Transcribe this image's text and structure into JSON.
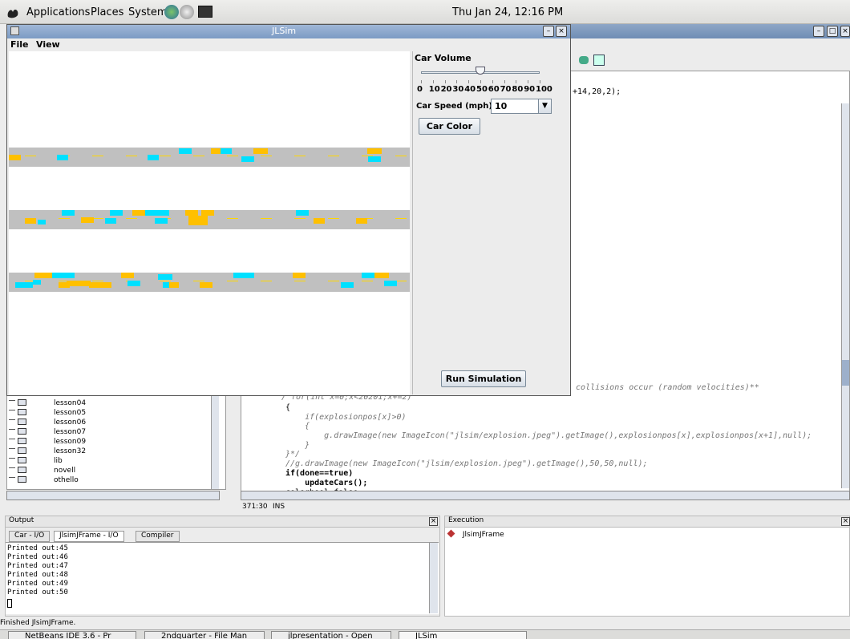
{
  "desktop": {
    "menus": [
      "Applications",
      "Places",
      "System"
    ],
    "clock": "Thu Jan 24, 12:16 PM"
  },
  "jlsim": {
    "title": "JLSim",
    "menu": [
      "File",
      "View"
    ],
    "car_volume_label": "Car Volume",
    "car_volume_value": 50,
    "car_volume_ticks": [
      "0",
      "10",
      "20",
      "30",
      "40",
      "50",
      "60",
      "70",
      "80",
      "90",
      "100"
    ],
    "car_speed_label": "Car Speed (mph):",
    "car_speed_value": "10",
    "car_color_button": "Car Color",
    "run_button": "Run Simulation",
    "colors": {
      "car_yellow": "#ffc000",
      "car_cyan": "#00e0ff",
      "road": "#c0c0c0"
    }
  },
  "editor": {
    "code_top": "+14,20,2);",
    "code_comment": "y collisions occur (random velocities)**",
    "lines": [
      "{",
      "    if(explosionpos[x]>0)",
      "    {",
      "        g.drawImage(new ImageIcon(\"jlsim/explosion.jpeg\").getImage(),explosionpos[x],explosionpos[x+1],null);",
      "    }",
      "}*/",
      "//g.drawImage(new ImageIcon(\"jlsim/explosion.jpeg\").getImage(),50,50,null);",
      "if(done==true)",
      "    updateCars();",
      "colorbool=false;"
    ],
    "cursor_pos": "371:30",
    "mode": "INS"
  },
  "project_tree": [
    "lesson04",
    "lesson05",
    "lesson06",
    "lesson07",
    "lesson09",
    "lesson32",
    "lib",
    "novell",
    "othello"
  ],
  "output": {
    "title": "Output",
    "tabs": [
      "Car - I/O",
      "JlsimJFrame - I/O",
      "Compiler"
    ],
    "lines": [
      "Printed out:45",
      "Printed out:46",
      "Printed out:47",
      "Printed out:48",
      "Printed out:49",
      "Printed out:50"
    ]
  },
  "execution": {
    "title": "Execution",
    "item": "JlsimJFrame"
  },
  "status_bar": "Finished JlsimJFrame.",
  "taskbar": [
    "NetBeans IDE 3.6 - Pr",
    "2ndquarter - File Man",
    "jlpresentation - Open",
    "JLSim"
  ]
}
